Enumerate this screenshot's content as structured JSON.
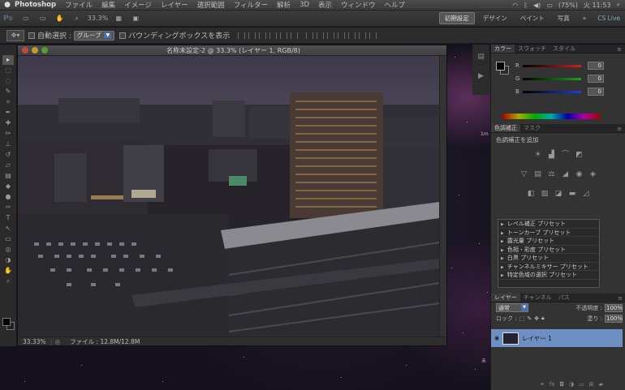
{
  "menubar": {
    "app_name": "Photoshop",
    "items": [
      "ファイル",
      "編集",
      "イメージ",
      "レイヤー",
      "選択範囲",
      "フィルター",
      "解析",
      "3D",
      "表示",
      "ウィンドウ",
      "ヘルプ"
    ],
    "battery": "(75%)",
    "clock": "火 11:53"
  },
  "appbar": {
    "ps_label": "Ps",
    "zoom": "33.3%",
    "workspaces": [
      "初期設定",
      "デザイン",
      "ペイント",
      "写真"
    ],
    "more": "»",
    "cs_live": "CS Live"
  },
  "options": {
    "auto_select_label": "自動選択 :",
    "auto_select_value": "グループ",
    "bounding_box_label": "バウンディングボックスを表示"
  },
  "document": {
    "title": "名称未設定-2 @ 33.3% (レイヤー 1, RGB/8)",
    "status_zoom": "33.33%",
    "status_file": "ファイル : 12.8M/12.8M"
  },
  "color_panel": {
    "tabs": [
      "カラー",
      "スウォッチ",
      "スタイル"
    ],
    "channels": [
      {
        "label": "R",
        "value": "0",
        "color": "#d02020"
      },
      {
        "label": "G",
        "value": "0",
        "color": "#20a020"
      },
      {
        "label": "B",
        "value": "0",
        "color": "#2040d0"
      }
    ]
  },
  "adjustments_panel": {
    "tabs": [
      "色調補正",
      "マスク"
    ],
    "subtitle": "色調補正を追加",
    "presets": [
      "レベル補正 プリセット",
      "トーンカーブ プリセット",
      "露光量 プリセット",
      "色相・彩度 プリセット",
      "白黒 プリセット",
      "チャンネルミキサー プリセット",
      "特定色域の選択 プリセット"
    ]
  },
  "layers_panel": {
    "tabs": [
      "レイヤー",
      "チャンネル",
      "パス"
    ],
    "blend_mode": "通常",
    "opacity_label": "不透明度 :",
    "opacity_value": "100%",
    "lock_label": "ロック :",
    "fill_label": "塗り :",
    "fill_value": "100%",
    "layer_name": "レイヤー 1"
  },
  "desktop": {
    "label_right": "1m",
    "label_bottom": "未"
  }
}
